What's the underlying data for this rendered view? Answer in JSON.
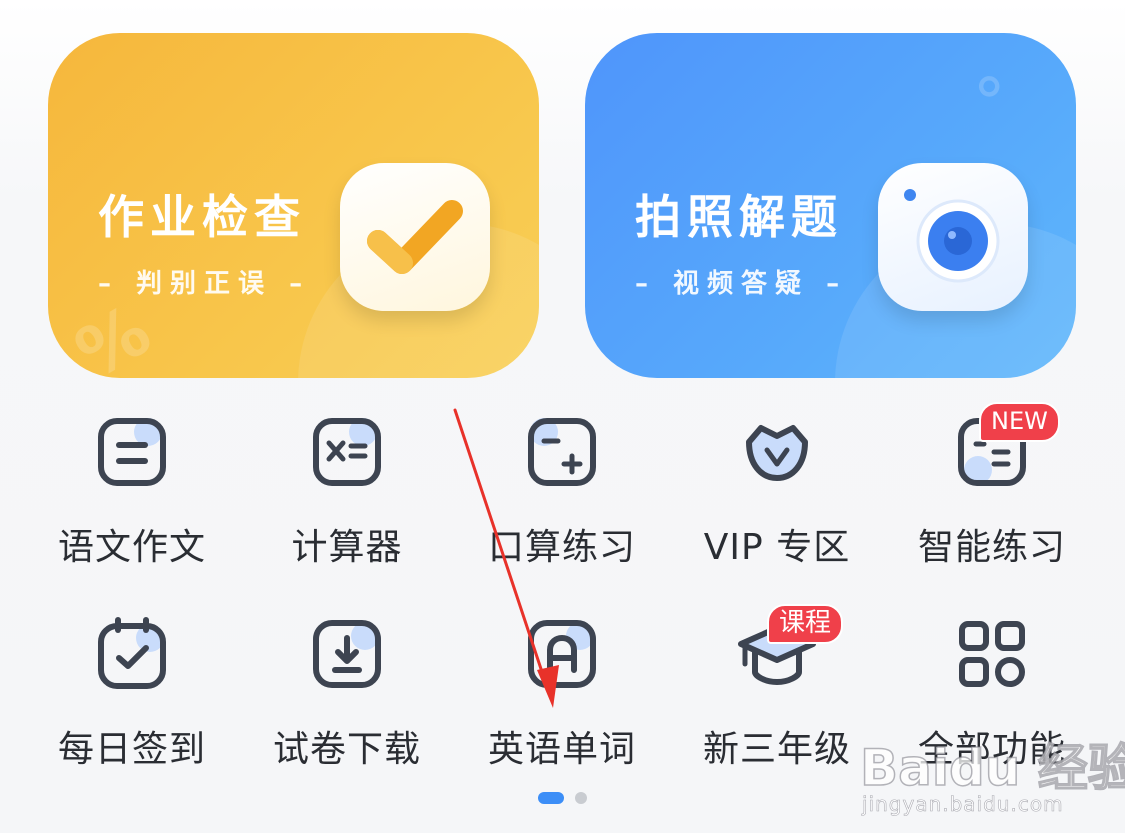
{
  "cards": [
    {
      "title": "作业检查",
      "subtitle": "– 判别正误 –",
      "icon": "checkmark-icon",
      "color": "#f7bd43"
    },
    {
      "title": "拍照解题",
      "subtitle": "– 视频答疑 –",
      "icon": "camera-icon",
      "color": "#549ffb"
    }
  ],
  "grid": {
    "row1": [
      {
        "label": "语文作文",
        "icon": "essay-icon"
      },
      {
        "label": "计算器",
        "icon": "calculator-icon"
      },
      {
        "label": "口算练习",
        "icon": "mental-math-icon"
      },
      {
        "label": "VIP 专区",
        "icon": "vip-crown-icon"
      },
      {
        "label": "智能练习",
        "icon": "smart-practice-icon",
        "badge": "NEW"
      }
    ],
    "row2": [
      {
        "label": "每日签到",
        "icon": "calendar-check-icon"
      },
      {
        "label": "试卷下载",
        "icon": "download-paper-icon"
      },
      {
        "label": "英语单词",
        "icon": "letter-a-icon"
      },
      {
        "label": "新三年级",
        "icon": "graduation-cap-icon",
        "badge": "课程"
      },
      {
        "label": "全部功能",
        "icon": "grid-apps-icon"
      }
    ]
  },
  "pager": {
    "pages": 2,
    "active_page": 1
  },
  "watermark": {
    "brand": "Baidu 经验",
    "url": "jingyan.baidu.com"
  },
  "colors": {
    "accent": "#3c8ef7",
    "icon_stroke": "#3d4451",
    "icon_fill": "#c9dcfb",
    "badge": "#f0404a",
    "arrow": "#e8322a"
  }
}
